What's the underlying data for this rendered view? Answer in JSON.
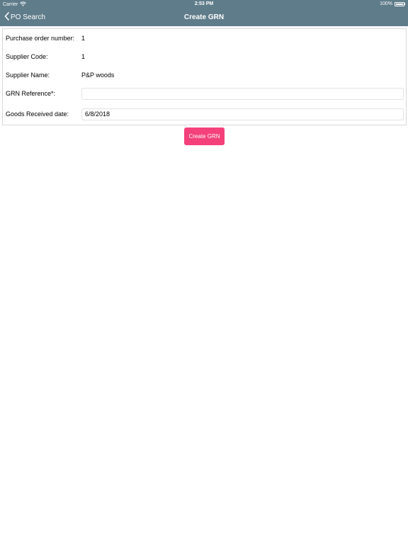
{
  "status_bar": {
    "carrier": "Carrier",
    "time": "2:53 PM",
    "battery": "100%"
  },
  "nav": {
    "back_label": "PO Search",
    "title": "Create GRN"
  },
  "form": {
    "po_number_label": "Purchase order number:",
    "po_number_value": "1",
    "supplier_code_label": "Supplier Code:",
    "supplier_code_value": "1",
    "supplier_name_label": "Supplier Name:",
    "supplier_name_value": "P&P woods",
    "grn_reference_label": "GRN Reference*:",
    "grn_reference_value": "",
    "goods_received_label": "Goods Received date:",
    "goods_received_value": "6/8/2018"
  },
  "actions": {
    "create_label": "Create GRN"
  },
  "colors": {
    "nav_background": "#5f7c8a",
    "create_button": "#f4417a"
  },
  "icons": {
    "wifi": "wifi-icon",
    "battery": "battery-icon",
    "back": "chevron-left-icon"
  }
}
